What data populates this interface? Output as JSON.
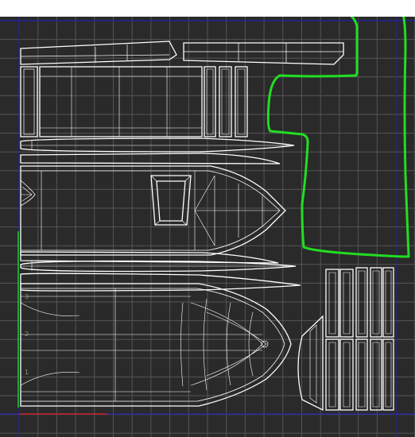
{
  "editor": {
    "name": "UV Editor",
    "background": "#2a2a2a",
    "grid_color": "#555555",
    "uv_wire_color": "#ffffff",
    "uv_origin_axis_color": "#1a1aa8",
    "selection_annotation_color": "#22dd22"
  },
  "axis_ticks": {
    "v_ticks": [
      "1",
      "2",
      "3"
    ]
  }
}
